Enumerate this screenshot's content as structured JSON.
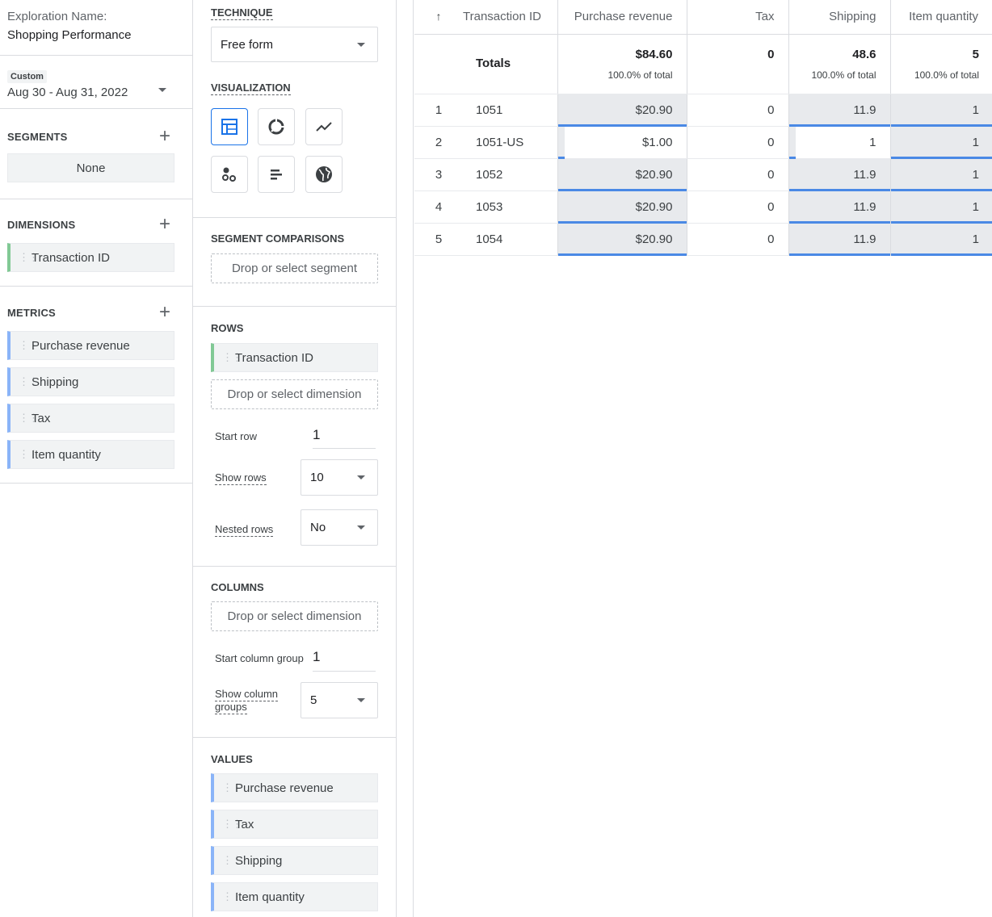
{
  "exploration": {
    "name_label": "Exploration Name:",
    "name_value": "Shopping Performance",
    "date_chip": "Custom",
    "date_range": "Aug 30 - Aug 31, 2022"
  },
  "variables": {
    "segments_title": "SEGMENTS",
    "segments_none": "None",
    "dimensions_title": "DIMENSIONS",
    "dimensions": [
      "Transaction ID"
    ],
    "metrics_title": "METRICS",
    "metrics": [
      "Purchase revenue",
      "Shipping",
      "Tax",
      "Item quantity"
    ]
  },
  "settings": {
    "technique_title": "TECHNIQUE",
    "technique_value": "Free form",
    "visualization_title": "VISUALIZATION",
    "vis_icons": [
      "table-icon",
      "donut-chart-icon",
      "line-chart-icon",
      "scatter-plot-icon",
      "bar-chart-icon",
      "geo-map-icon"
    ],
    "segment_comparisons_title": "SEGMENT COMPARISONS",
    "segment_drop": "Drop or select segment",
    "rows_title": "ROWS",
    "rows_dimension": "Transaction ID",
    "rows_drop": "Drop or select dimension",
    "start_row_label": "Start row",
    "start_row_value": "1",
    "show_rows_label": "Show rows",
    "show_rows_value": "10",
    "nested_rows_label": "Nested rows",
    "nested_rows_value": "No",
    "columns_title": "COLUMNS",
    "columns_drop": "Drop or select dimension",
    "start_col_label": "Start column group",
    "start_col_value": "1",
    "show_col_label_1": "Show column",
    "show_col_label_2": "groups",
    "show_col_value": "5",
    "values_title": "VALUES",
    "values": [
      "Purchase revenue",
      "Tax",
      "Shipping",
      "Item quantity"
    ]
  },
  "table": {
    "sort_icon": "↑",
    "headers": {
      "transaction_id": "Transaction ID",
      "purchase_revenue": "Purchase revenue",
      "tax": "Tax",
      "shipping": "Shipping",
      "item_quantity": "Item quantity"
    },
    "totals": {
      "label": "Totals",
      "purchase_revenue": "$84.60",
      "purchase_revenue_pct": "100.0% of total",
      "tax": "0",
      "shipping": "48.6",
      "shipping_pct": "100.0% of total",
      "item_quantity": "5",
      "item_quantity_pct": "100.0% of total"
    },
    "rows": [
      {
        "idx": "1",
        "tid": "1051",
        "revenue": "$20.90",
        "tax": "0",
        "shipping": "11.9",
        "qty": "1",
        "rev_frac": 1.0,
        "ship_frac": 1.0
      },
      {
        "idx": "2",
        "tid": "1051-US",
        "revenue": "$1.00",
        "tax": "0",
        "shipping": "1",
        "qty": "1",
        "rev_frac": 0.05,
        "ship_frac": 0.08
      },
      {
        "idx": "3",
        "tid": "1052",
        "revenue": "$20.90",
        "tax": "0",
        "shipping": "11.9",
        "qty": "1",
        "rev_frac": 1.0,
        "ship_frac": 1.0
      },
      {
        "idx": "4",
        "tid": "1053",
        "revenue": "$20.90",
        "tax": "0",
        "shipping": "11.9",
        "qty": "1",
        "rev_frac": 1.0,
        "ship_frac": 1.0
      },
      {
        "idx": "5",
        "tid": "1054",
        "revenue": "$20.90",
        "tax": "0",
        "shipping": "11.9",
        "qty": "1",
        "rev_frac": 1.0,
        "ship_frac": 1.0
      }
    ]
  },
  "colors": {
    "accent": "#1a73e8",
    "bar_underline": "#4a89e5",
    "dimension_chip": "#81c995",
    "metric_chip": "#8ab4f8",
    "bar_fill": "#e8eaed"
  }
}
